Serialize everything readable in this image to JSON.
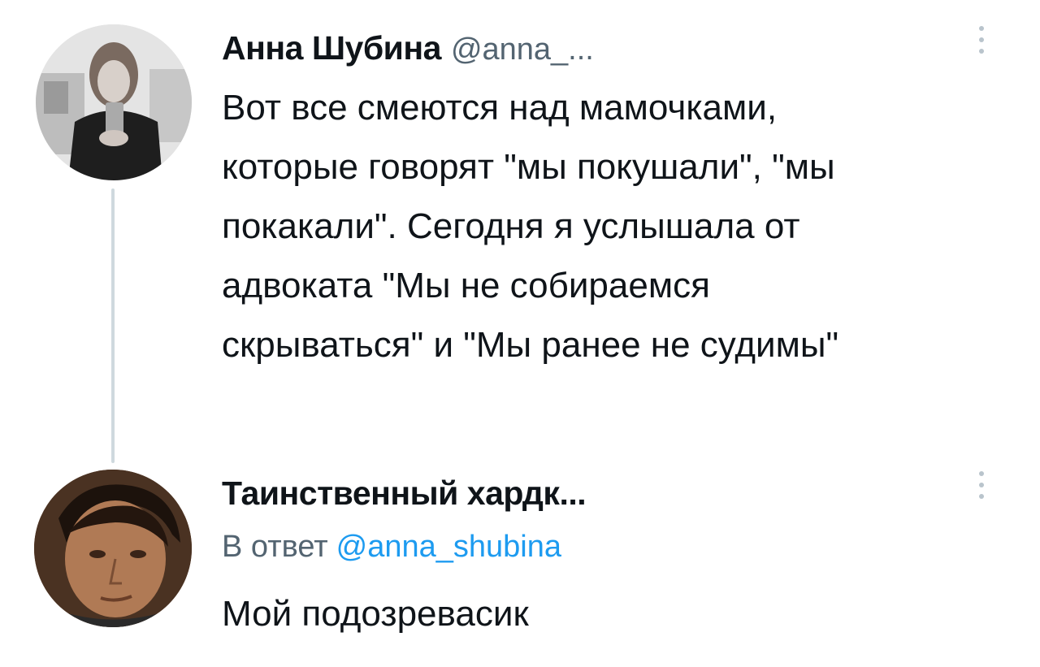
{
  "tweets": [
    {
      "author_name": "Анна Шубина",
      "handle": "@anna_...",
      "avatar": "user-photo-woman-with-phone",
      "text_lines": [
        "Вот все смеются над мамочками,",
        "которые говорят \"мы покушали\", \"мы",
        "покакали\". Сегодня я услышала от",
        "адвоката \"Мы не собираемся",
        "скрываться\" и \"Мы ранее не судимы\""
      ]
    },
    {
      "author_name": "Таинственный хардк...",
      "reply_prefix": "В ответ",
      "reply_mention": "@anna_shubina",
      "avatar": "user-photo-man-face",
      "text_lines": [
        "Мой подозревасик"
      ]
    }
  ],
  "colors": {
    "text": "#0f1419",
    "secondary": "#536471",
    "link": "#1d9bf0",
    "thread_line": "#cfd9de"
  },
  "icons": {
    "menu": "more-vertical-icon"
  }
}
